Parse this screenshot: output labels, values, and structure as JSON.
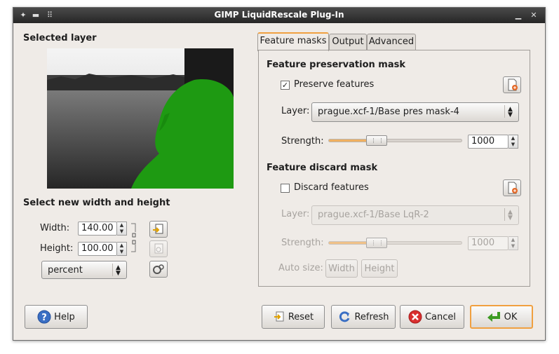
{
  "window": {
    "title": "GIMP LiquidRescale Plug-In"
  },
  "left": {
    "selected_layer_heading": "Selected layer",
    "size_heading": "Select new width and height",
    "width_label": "Width:",
    "width_value": "140.00",
    "height_label": "Height:",
    "height_value": "100.00",
    "unit_value": "percent"
  },
  "tabs": [
    "Feature masks",
    "Output",
    "Advanced"
  ],
  "preservation": {
    "heading": "Feature preservation mask",
    "checkbox_label": "Preserve features",
    "checked": true,
    "layer_label": "Layer:",
    "layer_value": "prague.xcf-1/Base pres mask-4",
    "strength_label": "Strength:",
    "strength_value": "1000"
  },
  "discard": {
    "heading": "Feature discard mask",
    "checkbox_label": "Discard features",
    "checked": false,
    "layer_label": "Layer:",
    "layer_value": "prague.xcf-1/Base LqR-2",
    "strength_label": "Strength:",
    "strength_value": "1000",
    "autosize_label": "Auto size:",
    "width_button": "Width",
    "height_button": "Height"
  },
  "buttons": {
    "help": "Help",
    "reset": "Reset",
    "refresh": "Refresh",
    "cancel": "Cancel",
    "ok": "OK"
  },
  "colors": {
    "accent": "#f0a040",
    "mask_green": "#1e9a12"
  }
}
